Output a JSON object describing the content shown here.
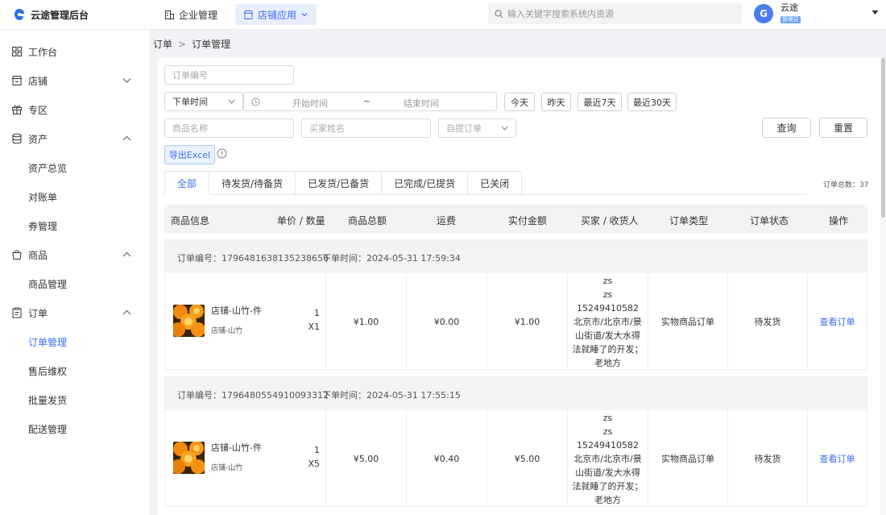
{
  "app": {
    "title": "云途管理后台"
  },
  "top_nav": [
    {
      "label": "企业管理",
      "active": false
    },
    {
      "label": "店铺应用",
      "active": true
    }
  ],
  "search": {
    "placeholder": "输入关键字搜索系统内资源"
  },
  "user": {
    "avatar_letter": "G",
    "name": "云途",
    "role": "管理员"
  },
  "sidebar": {
    "workbench": "工作台",
    "store": "店铺",
    "zone": "专区",
    "assets": "资产",
    "assets_overview": "资产总览",
    "statements": "对账单",
    "coupons": "券管理",
    "goods": "商品",
    "goods_manage": "商品管理",
    "orders": "订单",
    "order_manage": "订单管理",
    "after_sales": "售后维权",
    "batch_ship": "批量发货",
    "delivery": "配送管理"
  },
  "breadcrumb": {
    "parent": "订单",
    "sep": ">",
    "current": "订单管理"
  },
  "filters": {
    "order_no_placeholder": "订单编号",
    "time_type": "下单时间",
    "start_placeholder": "开始时间",
    "range_sep": "~",
    "end_placeholder": "结束时间",
    "quick_today": "今天",
    "quick_yesterday": "昨天",
    "quick_7": "最近7天",
    "quick_30": "最近30天",
    "product_placeholder": "商品名称",
    "buyer_placeholder": "买家姓名",
    "pickup_placeholder": "自提订单",
    "query": "查询",
    "reset": "重置",
    "export": "导出Excel"
  },
  "tabs": [
    {
      "label": "全部",
      "active": true
    },
    {
      "label": "待发货/待备货",
      "active": false
    },
    {
      "label": "已发货/已备货",
      "active": false
    },
    {
      "label": "已完成/已提货",
      "active": false
    },
    {
      "label": "已关闭",
      "active": false
    }
  ],
  "total": "订单总数：37",
  "table_headers": [
    "商品信息",
    "单价 / 数量",
    "商品总额",
    "运费",
    "实付金额",
    "买家 / 收货人",
    "订单类型",
    "订单状态",
    "操作"
  ],
  "orders": [
    {
      "order_no": "订单编号：1796481638135238656",
      "order_time": "下单时间：2024-05-31 17:59:34",
      "product_name": "店铺-山竹-件",
      "shop": "店铺-山竹",
      "unit_price": "1",
      "quantity": "X1",
      "goods_total": "¥1.00",
      "shipping": "¥0.00",
      "paid": "¥1.00",
      "buyer": "zs\nzs 15249410582\n北京市/北京市/景山街道/发大水得法就睡了的开发；老地方",
      "type": "实物商品订单",
      "status": "待发货",
      "action": "查看订单"
    },
    {
      "order_no": "订单编号：1796480554910093312",
      "order_time": "下单时间：2024-05-31 17:55:15",
      "product_name": "店铺-山竹-件",
      "shop": "店铺-山竹",
      "unit_price": "1",
      "quantity": "X5",
      "goods_total": "¥5.00",
      "shipping": "¥0.40",
      "paid": "¥5.00",
      "buyer": "zs\nzs 15249410582\n北京市/北京市/景山街道/发大水得法就睡了的开发；老地方",
      "type": "实物商品订单",
      "status": "待发货",
      "action": "查看订单"
    }
  ],
  "colors": {
    "accent": "#3a6ff2",
    "active_nav_bg": "#e8eefc",
    "avatar": "#4a7cf0"
  },
  "icons": [
    "logo-icon",
    "building-icon",
    "store-app-icon",
    "search-icon",
    "caret-down-icon",
    "grid-icon",
    "shop-icon",
    "gift-icon",
    "database-icon",
    "bag-icon",
    "clipboard-icon",
    "clock-icon",
    "info-icon",
    "chevron-icon"
  ]
}
